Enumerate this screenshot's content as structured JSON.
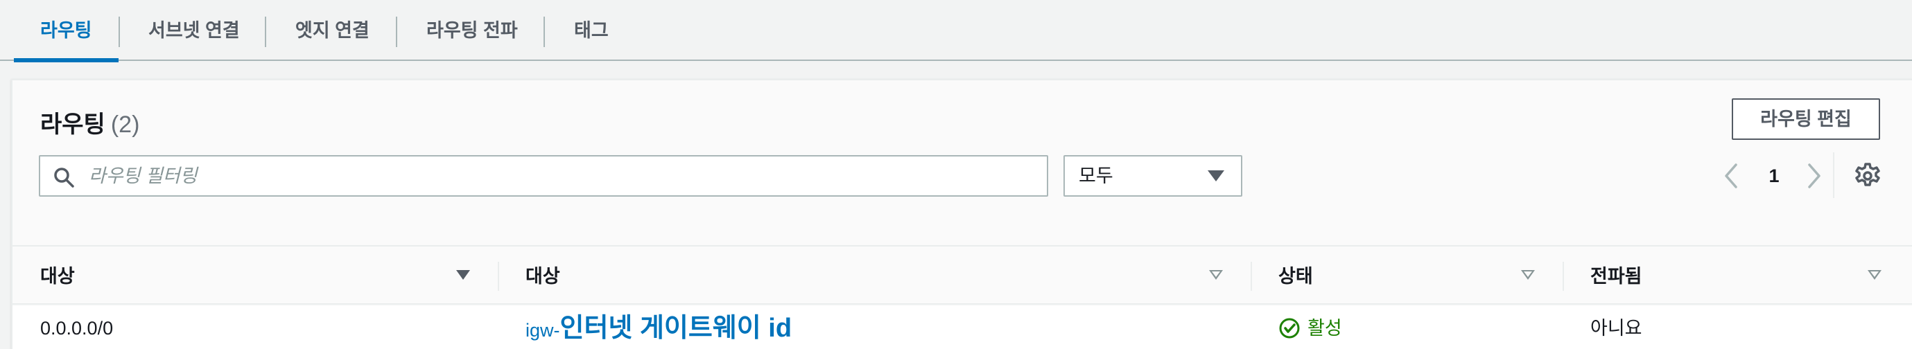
{
  "tabs": [
    {
      "label": "라우팅",
      "active": true
    },
    {
      "label": "서브넷 연결"
    },
    {
      "label": "엣지 연결"
    },
    {
      "label": "라우팅 전파"
    },
    {
      "label": "태그"
    }
  ],
  "panel": {
    "title": "라우팅",
    "count": "(2)",
    "edit_button": "라우팅 편집",
    "search_placeholder": "라우팅 필터링",
    "filter_select": "모두",
    "page_number": "1"
  },
  "table": {
    "headers": [
      "대상",
      "대상",
      "상태",
      "전파됨"
    ],
    "rows": [
      {
        "destination": "0.0.0.0/0",
        "target_prefix": "igw-",
        "target_id": "인터넷 게이트웨이 id",
        "status": "활성",
        "propagated": "아니요"
      }
    ]
  },
  "colors": {
    "accent": "#0073bb",
    "success": "#1d8102",
    "border": "#aab7b8"
  },
  "icons": [
    "search-icon",
    "caret-down-icon",
    "chevron-left-icon",
    "chevron-right-icon",
    "gear-icon",
    "sort-icon",
    "status-success-icon"
  ]
}
